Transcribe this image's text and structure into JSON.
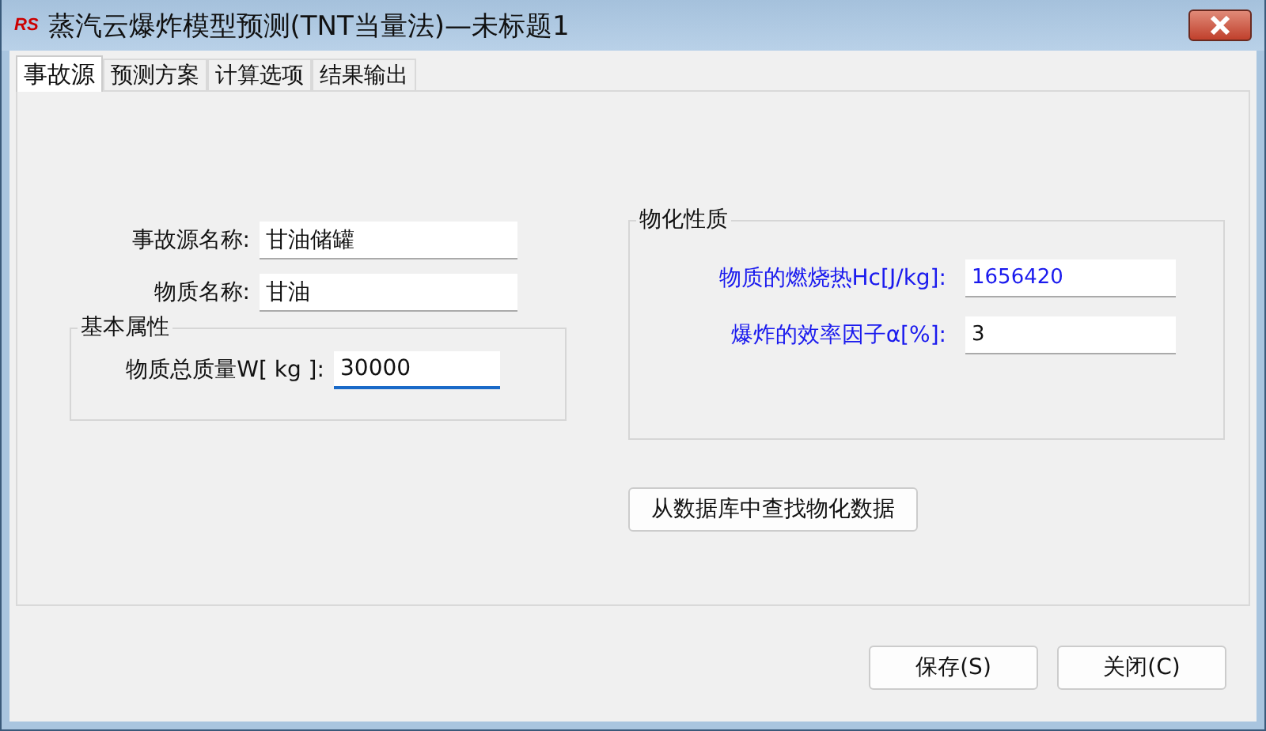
{
  "window": {
    "logo": "RS",
    "title": "蒸汽云爆炸模型预测(TNT当量法)—未标题1"
  },
  "tabs": [
    {
      "label": "事故源",
      "selected": true
    },
    {
      "label": "预测方案",
      "selected": false
    },
    {
      "label": "计算选项",
      "selected": false
    },
    {
      "label": "结果输出",
      "selected": false
    }
  ],
  "source_fields": [
    {
      "label": "事故源名称:",
      "value": "甘油储罐"
    },
    {
      "label": "物质名称:",
      "value": "甘油"
    }
  ],
  "basic_group": {
    "title": "基本属性",
    "fields": [
      {
        "label": "物质总质量W[ kg ]:",
        "value": "30000",
        "focused": true
      }
    ]
  },
  "physchem_group": {
    "title": "物化性质",
    "fields": [
      {
        "label": "物质的燃烧热Hc[J/kg]:",
        "value": "1656420"
      },
      {
        "label": "爆炸的效率因子α[%]:",
        "value": "3"
      }
    ]
  },
  "lookup_button": "从数据库中查找物化数据",
  "buttons": [
    "保存(S)",
    "关闭(C)"
  ]
}
